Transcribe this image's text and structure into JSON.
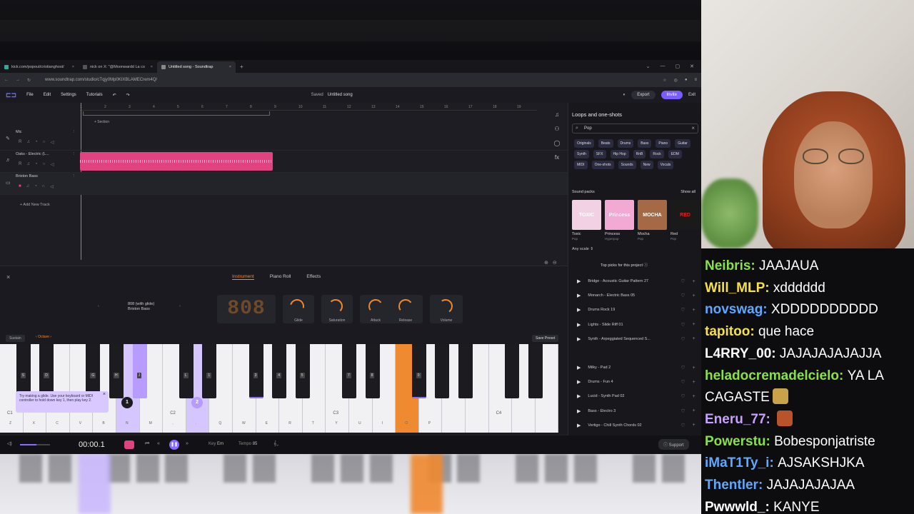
{
  "browser": {
    "tabs": [
      {
        "label": "kick.com/popout/cristianghost/",
        "active": false
      },
      {
        "label": "nick on X: \"@Moonwardd La co",
        "active": false
      },
      {
        "label": "Untitled song - Soundtrap",
        "active": true
      }
    ],
    "url": "www.soundtrap.com/studio/cTqjy0Mp0KIXBLAMECrem4Q/"
  },
  "app": {
    "menu": [
      "File",
      "Edit",
      "Settings",
      "Tutorials"
    ],
    "saved_label": "Saved",
    "song_title": "Untitled song",
    "export_label": "Export",
    "invite_label": "Invite",
    "exit_label": "Exit"
  },
  "tracks": {
    "section_label": "+ Section",
    "ruler": [
      "1",
      "2",
      "3",
      "4",
      "5",
      "6",
      "7",
      "8",
      "9",
      "10",
      "11",
      "12",
      "13",
      "14",
      "15",
      "16",
      "17",
      "18",
      "19"
    ],
    "items": [
      {
        "name": "Mic"
      },
      {
        "name": "Oaks - Electric (L..."
      },
      {
        "name": "Brixton Bass"
      }
    ],
    "add_track_label": "+ Add New Track"
  },
  "loops": {
    "title": "Loops and one-shots",
    "search_value": "Pop",
    "filters": [
      "Originals",
      "Beats",
      "Drums",
      "Bass",
      "Piano",
      "Guitar",
      "Synth",
      "SFX",
      "Hip Hop",
      "RnB",
      "Rock",
      "EDM",
      "MIDI",
      "One-shots",
      "Sounds",
      "New",
      "Vocals"
    ],
    "sound_packs_label": "Sound packs",
    "show_all_label": "Show all",
    "packs": [
      {
        "name": "Toxic",
        "genre": "Pop",
        "art": "TOXIC",
        "color": "#f3d1e4"
      },
      {
        "name": "Princess",
        "genre": "Hyperpop",
        "art": "Princess",
        "color": "#f2a9d4"
      },
      {
        "name": "Mocha",
        "genre": "Pop",
        "art": "MOCHA",
        "color": "#a56a45"
      },
      {
        "name": "Red",
        "genre": "Pop",
        "art": "RED",
        "color": "#1a1a1a"
      }
    ],
    "any_scale_label": "Any scale",
    "top_picks_label": "Top picks for this project",
    "items_group1": [
      "Bridge - Acoustic Guitar Pattern 27",
      "Monarch - Electric Bass 05",
      "Drums Rock 19",
      "Lights - Slide Riff 01",
      "Synth - Arpeggiated Sequenced S..."
    ],
    "items_group2": [
      "Milky - Pad 2",
      "Drums - Fun 4",
      "Lucid - Synth Pad 02",
      "Bass - Electro 3",
      "Vertigo - Chill Synth Chords 02"
    ]
  },
  "instrument": {
    "tabs": [
      "Instrument",
      "Piano Roll",
      "Effects"
    ],
    "active_tab": "Instrument",
    "preset_name": "808 (with glide)",
    "preset_sub": "Brixton Bass",
    "display": "808",
    "knobs": [
      "Glide",
      "Saturation",
      "Attack",
      "Release",
      "Volume"
    ],
    "sustain_label": "Sustain",
    "octave_label": "Octave",
    "save_preset_label": "Save Preset",
    "hint_text": "Try making a glide. Use your keyboard or MIDI controller to hold down key 1, then play key 2.",
    "badge1": "1",
    "badge2": "2",
    "octave_marks": [
      "C1",
      "C2",
      "C3",
      "C4"
    ],
    "white_key_letters": [
      "Z",
      "X",
      "C",
      "V",
      "B",
      "N",
      "M",
      ",",
      ".",
      "Q",
      "W",
      "E",
      "R",
      "T",
      "Y",
      "U",
      "I",
      "O",
      "P"
    ],
    "black_key_letters": [
      "S",
      "D",
      "G",
      "H",
      "J",
      "L",
      "1",
      "3",
      "4",
      "5",
      "7",
      "8",
      "0"
    ]
  },
  "transport": {
    "time": "00:00.1",
    "key_label": "Key",
    "key_value": "Em",
    "tempo_label": "Tempo",
    "tempo_value": "85",
    "support_label": "Support",
    "volume_level": 0.55
  },
  "chat": [
    {
      "user": "Neibris",
      "color": "#8be04a",
      "text": "JAAJAUA"
    },
    {
      "user": "Will_MLP",
      "color": "#f4e04a",
      "text": "xdddddd"
    },
    {
      "user": "novswag",
      "color": "#5fa8ff",
      "text": "XDDDDDDDDDD"
    },
    {
      "user": "tapitoo",
      "color": "#f4e04a",
      "text": "que hace"
    },
    {
      "user": "L4RRY_00",
      "color": "#ffffff",
      "text": "JAJAJAJAJAJJA"
    },
    {
      "user": "heladocremadelcielo",
      "color": "#8be04a",
      "text": "YA LA"
    },
    {
      "user": "",
      "color": "#ffffff",
      "text": "CAGASTE"
    },
    {
      "user": "Eneru_77",
      "color": "#c8a0ff",
      "text": ""
    },
    {
      "user": "Powerstu",
      "color": "#8be04a",
      "text": "Bobesponjatriste"
    },
    {
      "user": "iMaT1Ty_i",
      "color": "#5fa8ff",
      "text": "AJSAKSHJKA"
    },
    {
      "user": "Thentler",
      "color": "#5fa8ff",
      "text": "JAJAJAJAJAA"
    },
    {
      "user": "Pwwwld_",
      "color": "#ffffff",
      "text": "KANYE"
    }
  ]
}
